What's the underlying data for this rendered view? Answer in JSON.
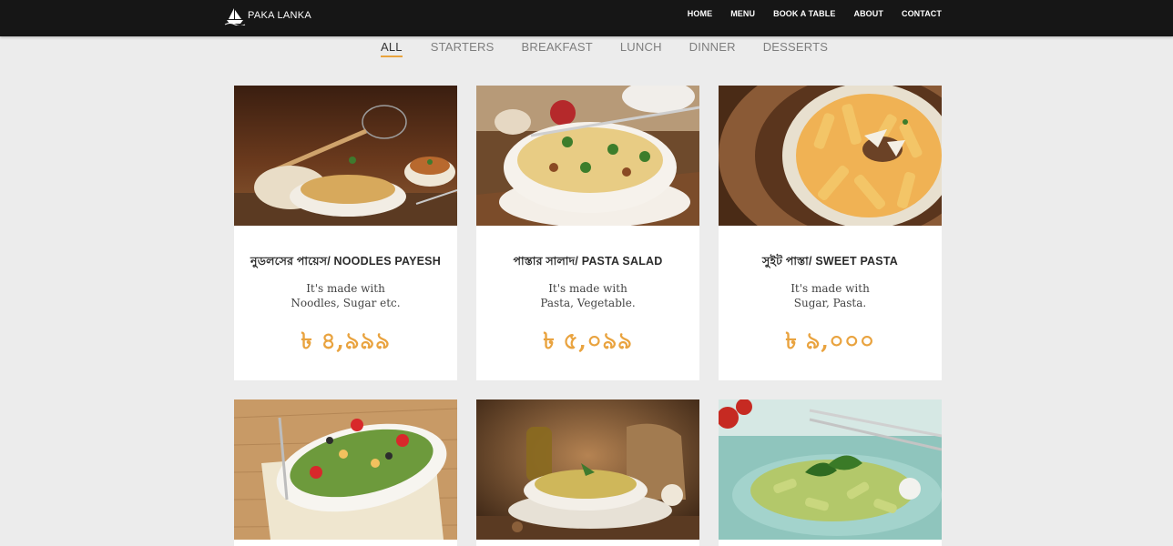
{
  "brand": {
    "name": "PAKA LANKA",
    "logo_icon": "ship-logo-icon"
  },
  "nav": [
    "HOME",
    "MENU",
    "BOOK A TABLE",
    "ABOUT",
    "CONTACT"
  ],
  "tabs": [
    {
      "label": "ALL",
      "active": true
    },
    {
      "label": "STARTERS",
      "active": false
    },
    {
      "label": "BREAKFAST",
      "active": false
    },
    {
      "label": "LUNCH",
      "active": false
    },
    {
      "label": "DINNER",
      "active": false
    },
    {
      "label": "DESSERTS",
      "active": false
    }
  ],
  "colors": {
    "accent": "#e8a33d",
    "header_bg": "#161616",
    "page_bg": "#ececec"
  },
  "menu_items": [
    {
      "title": "নুডলসের পায়েস/ NOODLES PAYESH",
      "desc_line1": "It's made with",
      "desc_line2": "Noodles, Sugar etc.",
      "price": "৳ ৪,৯৯৯",
      "image": "noodles-payesh-photo"
    },
    {
      "title": "পাস্তার সালাদ/ PASTA SALAD",
      "desc_line1": "It's made with",
      "desc_line2": "Pasta, Vegetable.",
      "price": "৳ ৫,০৯৯",
      "image": "pasta-salad-photo"
    },
    {
      "title": "সুইট পাস্তা/ SWEET PASTA",
      "desc_line1": "It's made with",
      "desc_line2": "Sugar, Pasta.",
      "price": "৳ ৯,০০০",
      "image": "sweet-pasta-photo"
    },
    {
      "image": "pasta-tomato-salad-photo"
    },
    {
      "image": "pesto-penne-photo"
    },
    {
      "image": "green-pasta-photo"
    }
  ]
}
